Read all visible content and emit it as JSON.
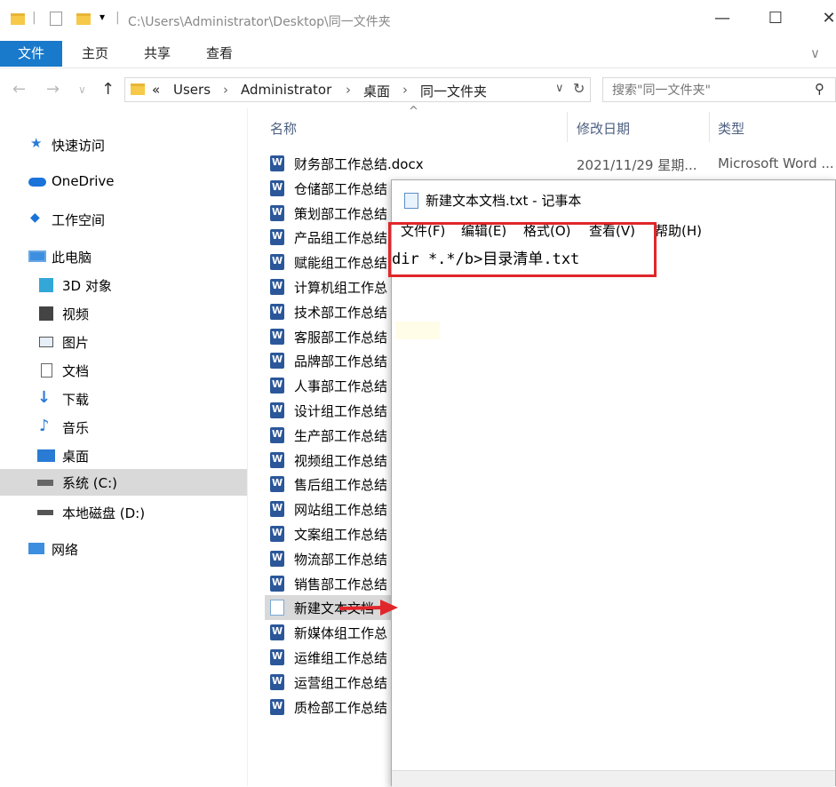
{
  "titlebar": {
    "path": "C:\\Users\\Administrator\\Desktop\\同一文件夹",
    "minimize": "—",
    "maximize": "☐",
    "close": "✕"
  },
  "ribbon": {
    "tabs": [
      "文件",
      "主页",
      "共享",
      "查看"
    ],
    "expand": "∨"
  },
  "address": {
    "crumbs": [
      "«",
      "Users",
      "›",
      "Administrator",
      "›",
      "桌面",
      "›",
      "同一文件夹"
    ],
    "search_placeholder": "搜索\"同一文件夹\""
  },
  "sidebar": {
    "items": [
      {
        "label": "快速访问",
        "icon": "star-icon"
      },
      {
        "label": "OneDrive",
        "icon": "cloud-icon"
      },
      {
        "label": "工作空间",
        "icon": "workspace-icon"
      },
      {
        "label": "此电脑",
        "icon": "computer-icon"
      },
      {
        "label": "3D 对象",
        "icon": "cube-icon"
      },
      {
        "label": "视频",
        "icon": "video-icon"
      },
      {
        "label": "图片",
        "icon": "picture-icon"
      },
      {
        "label": "文档",
        "icon": "document-icon"
      },
      {
        "label": "下载",
        "icon": "download-icon"
      },
      {
        "label": "音乐",
        "icon": "music-icon"
      },
      {
        "label": "桌面",
        "icon": "desktop-icon"
      },
      {
        "label": "系统 (C:)",
        "icon": "drive-c-icon"
      },
      {
        "label": "本地磁盘 (D:)",
        "icon": "drive-icon"
      },
      {
        "label": "网络",
        "icon": "network-icon"
      }
    ]
  },
  "filelist": {
    "columns": [
      "名称",
      "修改日期",
      "类型"
    ],
    "sort_indicator": "^",
    "first_row": {
      "date": "2021/11/29 星期...",
      "type": "Microsoft Word ..."
    },
    "rows": [
      "财务部工作总结.docx",
      "仓储部工作总结",
      "策划部工作总结",
      "产品组工作总结",
      "赋能组工作总结",
      "计算机组工作总",
      "技术部工作总结",
      "客服部工作总结",
      "品牌部工作总结",
      "人事部工作总结",
      "设计组工作总结",
      "生产部工作总结",
      "视频组工作总结",
      "售后组工作总结",
      "网站组工作总结",
      "文案组工作总结",
      "物流部工作总结",
      "销售部工作总结",
      "新建文本文档",
      "新媒体组工作总",
      "运维组工作总结",
      "运营组工作总结",
      "质检部工作总结"
    ]
  },
  "notepad": {
    "title": "新建文本文档.txt - 记事本",
    "menu": [
      "文件(F)",
      "编辑(E)",
      "格式(O)",
      "查看(V)",
      "帮助(H)"
    ],
    "content": "dir *.*/b>目录清单.txt"
  },
  "colors": {
    "accent": "#1979ca",
    "highlight_box": "#e0262a",
    "selection": "#d9d9d9"
  }
}
